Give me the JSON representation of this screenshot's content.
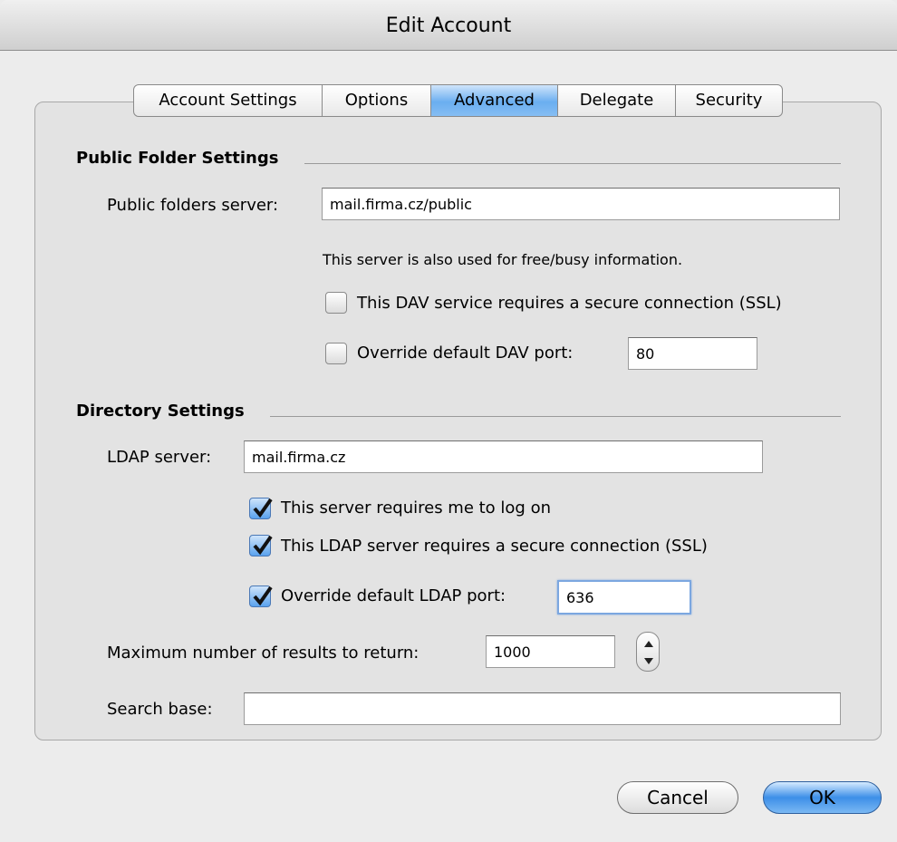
{
  "window": {
    "title": "Edit Account"
  },
  "tabs": [
    {
      "label": "Account Settings"
    },
    {
      "label": "Options"
    },
    {
      "label": "Advanced"
    },
    {
      "label": "Delegate"
    },
    {
      "label": "Security"
    }
  ],
  "active_tab": "Advanced",
  "public_folder": {
    "section_title": "Public Folder Settings",
    "server_label": "Public folders server:",
    "server_value": "mail.firma.cz/public",
    "info": "This server is also used for free/busy information.",
    "ssl_label": "This DAV service requires a secure connection (SSL)",
    "ssl_checked": false,
    "port_label": "Override default DAV port:",
    "port_checked": false,
    "port_value": "80"
  },
  "directory": {
    "section_title": "Directory Settings",
    "ldap_label": "LDAP server:",
    "ldap_value": "mail.firma.cz",
    "logon_label": "This server requires me to log on",
    "logon_checked": true,
    "ssl_label": "This LDAP server requires a secure connection (SSL)",
    "ssl_checked": true,
    "port_label": "Override default LDAP port:",
    "port_checked": true,
    "port_value": "636",
    "max_label": "Maximum number of results to return:",
    "max_value": "1000",
    "search_label": "Search base:",
    "search_value": ""
  },
  "buttons": {
    "cancel": "Cancel",
    "ok": "OK"
  },
  "colors": {
    "accent": "#5aa2ee",
    "window_bg": "#ececec"
  }
}
